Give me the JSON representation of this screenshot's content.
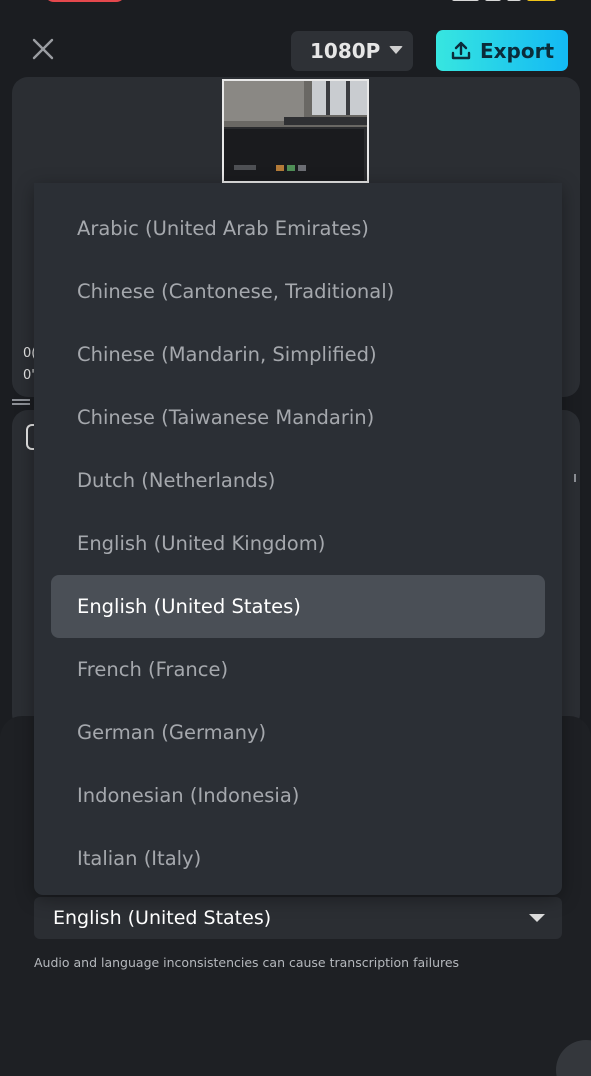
{
  "header": {
    "resolution_label": "1080P",
    "export_label": "Export"
  },
  "timeline": {
    "timecode_top": "0(",
    "timecode_bottom": "0'"
  },
  "language_dropdown": {
    "options": [
      "Arabic (United Arab Emirates)",
      "Chinese (Cantonese, Traditional)",
      "Chinese (Mandarin, Simplified)",
      "Chinese (Taiwanese Mandarin)",
      "Dutch (Netherlands)",
      "English (United Kingdom)",
      "English (United States)",
      "French (France)",
      "German (Germany)",
      "Indonesian (Indonesia)",
      "Italian (Italy)"
    ],
    "selected_index": 6
  },
  "language_select": {
    "value": "English (United States)"
  },
  "warning": "Audio and language inconsistencies can cause transcription failures",
  "colors": {
    "background": "#1b1d21",
    "panel": "#2b2e33",
    "dropdown": "#2b2f35",
    "selected_option": "#4a4f56",
    "export_gradient_start": "#37e6e0",
    "export_gradient_end": "#13b9f4"
  },
  "icons": {
    "close": "close-icon",
    "export": "upload-icon",
    "resolution_caret": "caret-down-icon",
    "language_caret": "caret-down-icon"
  }
}
